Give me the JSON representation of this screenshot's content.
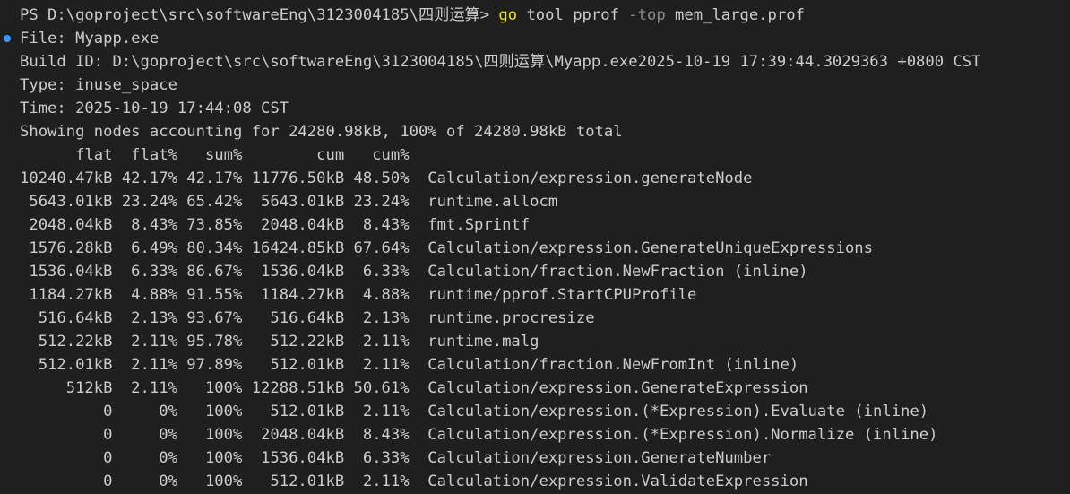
{
  "prompt": {
    "text": "PS D:\\goproject\\src\\softwareEng\\3123004185\\四则运算> ",
    "command": "go",
    "subcommand": " tool pprof ",
    "flag": "-top",
    "argument": " mem_large.prof"
  },
  "meta": {
    "file": "File: Myapp.exe",
    "build_id": "Build ID: D:\\goproject\\src\\softwareEng\\3123004185\\四则运算\\Myapp.exe2025-10-19 17:39:44.3029363 +0800 CST",
    "type": "Type: inuse_space",
    "time": "Time: 2025-10-19 17:44:08 CST",
    "summary": "Showing nodes accounting for 24280.98kB, 100% of 24280.98kB total"
  },
  "table": {
    "header": "      flat  flat%   sum%        cum   cum%",
    "rows": [
      "10240.47kB 42.17% 42.17% 11776.50kB 48.50%  Calculation/expression.generateNode",
      " 5643.01kB 23.24% 65.42%  5643.01kB 23.24%  runtime.allocm",
      " 2048.04kB  8.43% 73.85%  2048.04kB  8.43%  fmt.Sprintf",
      " 1576.28kB  6.49% 80.34% 16424.85kB 67.64%  Calculation/expression.GenerateUniqueExpressions",
      " 1536.04kB  6.33% 86.67%  1536.04kB  6.33%  Calculation/fraction.NewFraction (inline)",
      " 1184.27kB  4.88% 91.55%  1184.27kB  4.88%  runtime/pprof.StartCPUProfile",
      "  516.64kB  2.13% 93.67%   516.64kB  2.13%  runtime.procresize",
      "  512.22kB  2.11% 95.78%   512.22kB  2.11%  runtime.malg",
      "  512.01kB  2.11% 97.89%   512.01kB  2.11%  Calculation/fraction.NewFromInt (inline)",
      "     512kB  2.11%   100% 12288.51kB 50.61%  Calculation/expression.GenerateExpression",
      "         0     0%   100%   512.01kB  2.11%  Calculation/expression.(*Expression).Evaluate (inline)",
      "         0     0%   100%  2048.04kB  8.43%  Calculation/expression.(*Expression).Normalize (inline)",
      "         0     0%   100%  1536.04kB  6.33%  Calculation/expression.GenerateNumber",
      "         0     0%   100%   512.01kB  2.11%  Calculation/expression.ValidateExpression"
    ]
  },
  "colors": {
    "background": "#1f1f1f",
    "text": "#cccccc",
    "command": "#e5e510",
    "flag": "#8a8a8a",
    "marker": "#3794ff"
  }
}
